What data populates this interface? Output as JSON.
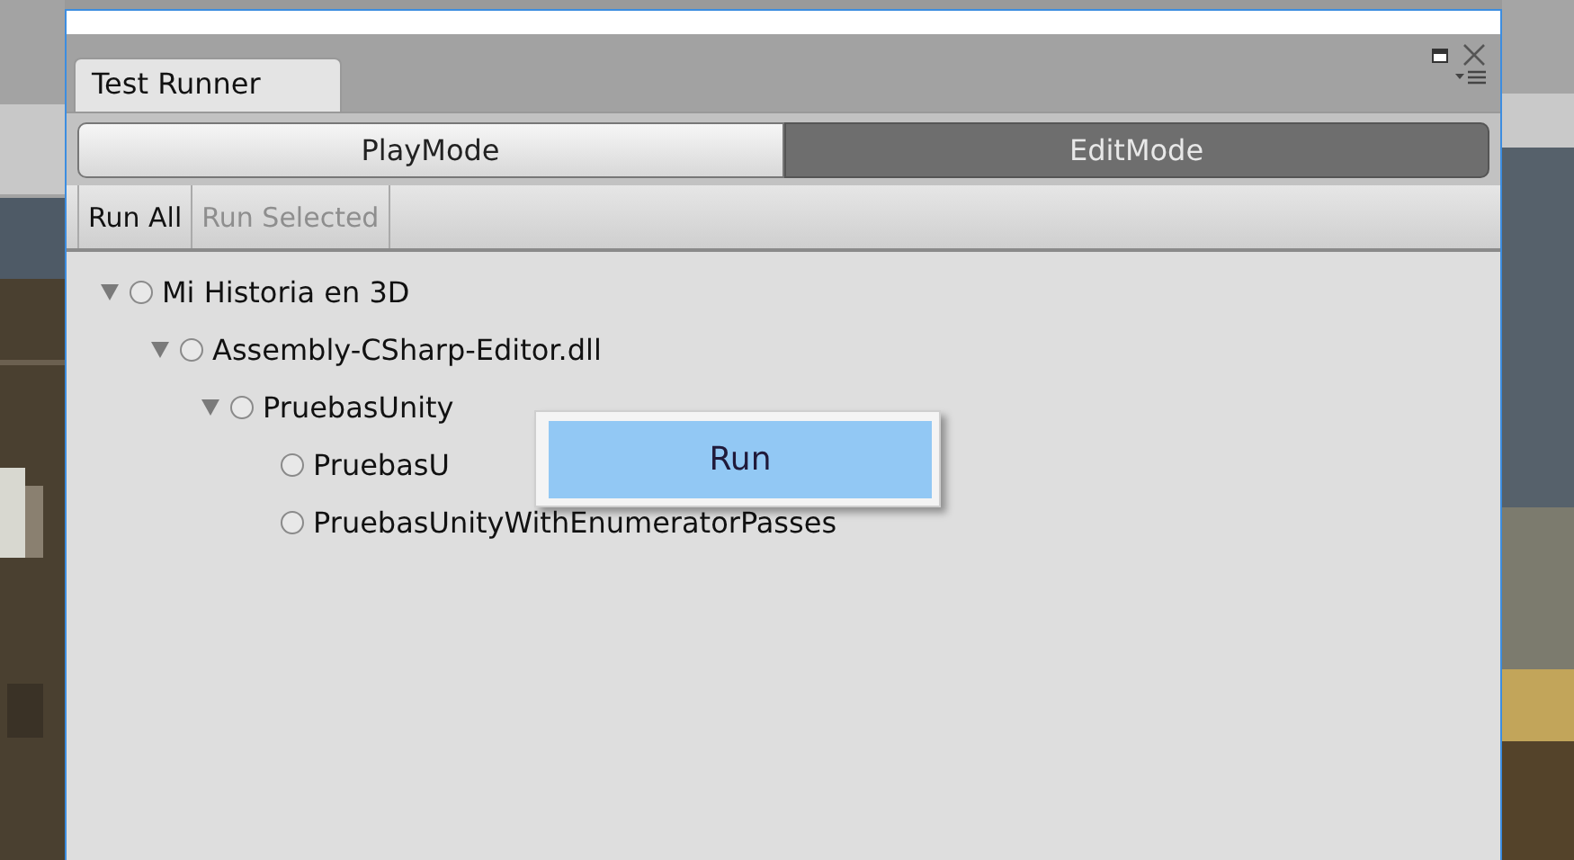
{
  "window": {
    "tab": "Test Runner"
  },
  "mode_tabs": [
    {
      "label": "PlayMode",
      "selected": false
    },
    {
      "label": "EditMode",
      "selected": true
    }
  ],
  "toolbar": [
    {
      "label": "Run All",
      "disabled": false
    },
    {
      "label": "Run Selected",
      "disabled": true
    }
  ],
  "tree": [
    {
      "label": "Mi Historia en 3D",
      "expanded": true,
      "children": [
        {
          "label": "Assembly-CSharp-Editor.dll",
          "expanded": true,
          "children": [
            {
              "label": "PruebasUnity",
              "expanded": true,
              "children": [
                {
                  "label": "PruebasU"
                },
                {
                  "label": "PruebasUnityWithEnumeratorPasses"
                }
              ]
            }
          ]
        }
      ]
    }
  ],
  "context_menu": [
    {
      "label": "Run",
      "selected": true
    }
  ]
}
